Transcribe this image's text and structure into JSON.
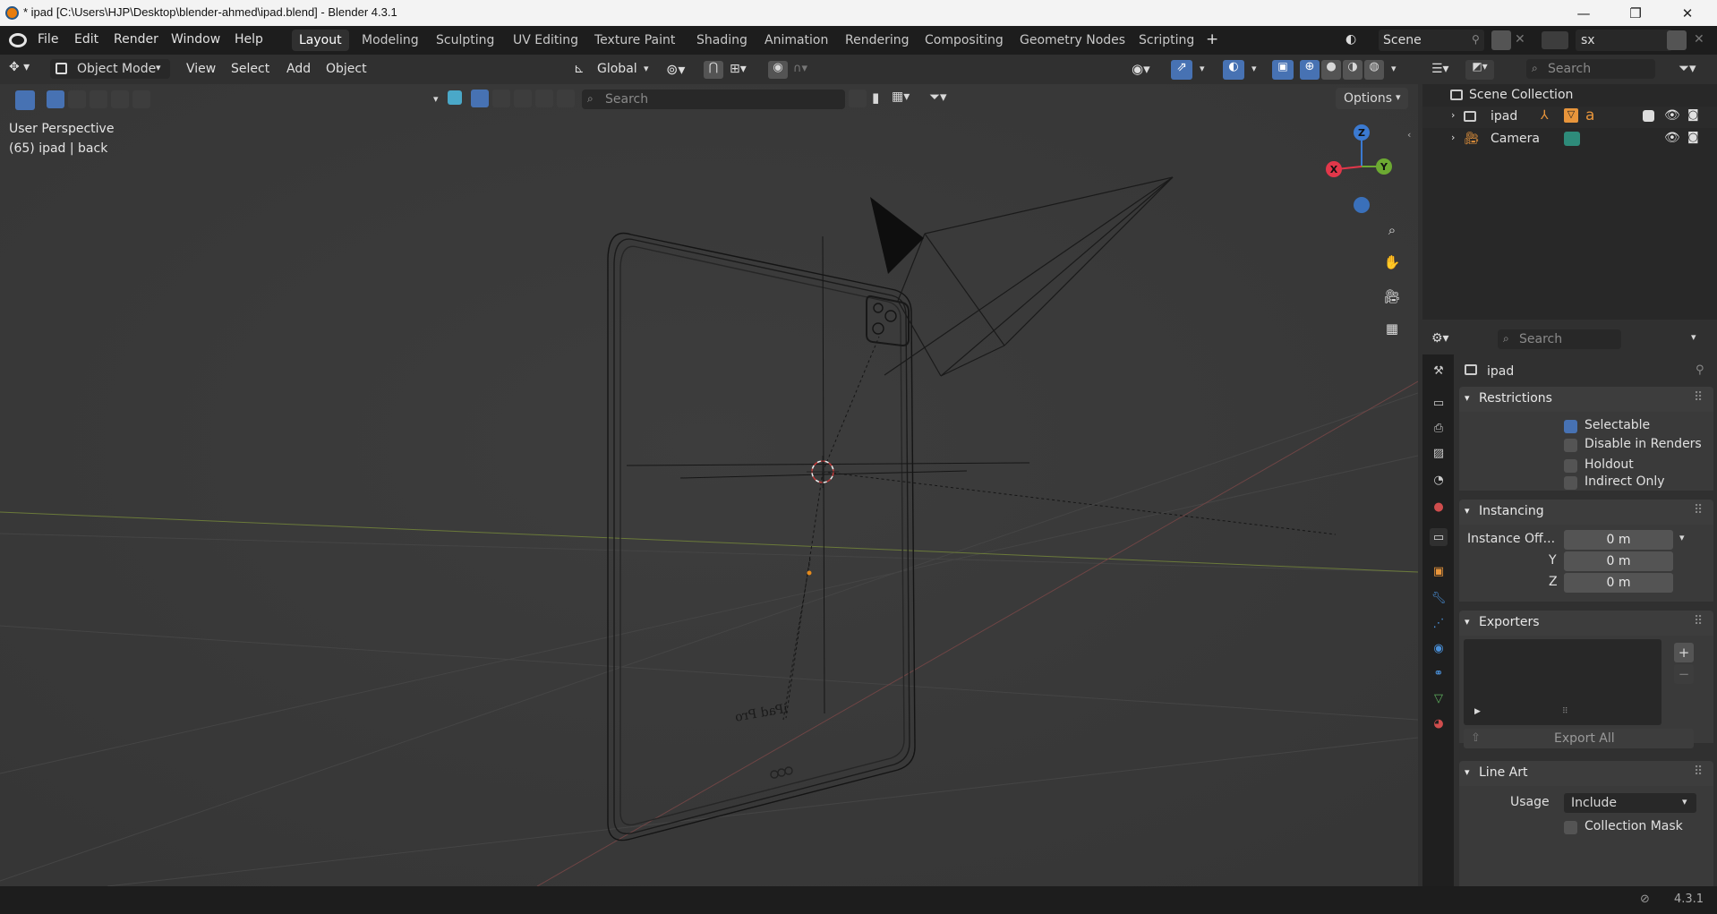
{
  "window": {
    "title": "* ipad [C:\\Users\\HJP\\Desktop\\blender-ahmed\\ipad.blend] - Blender 4.3.1",
    "controls": {
      "minimize": "—",
      "maximize": "❐",
      "close": "✕"
    }
  },
  "menu": {
    "file": "File",
    "edit": "Edit",
    "render": "Render",
    "window": "Window",
    "help": "Help"
  },
  "workspaces": [
    "Layout",
    "Modeling",
    "Sculpting",
    "UV Editing",
    "Texture Paint",
    "Shading",
    "Animation",
    "Rendering",
    "Compositing",
    "Geometry Nodes",
    "Scripting"
  ],
  "workspace_add": "+",
  "scene": {
    "name": "Scene",
    "view_layer": "sx"
  },
  "viewport_header": {
    "mode": "Object Mode",
    "view": "View",
    "select": "Select",
    "add": "Add",
    "object": "Object",
    "orientation": "Global",
    "search_placeholder": "Search",
    "options": "Options"
  },
  "viewport": {
    "perspective": "User Perspective",
    "collection_info": "(65) ipad | back",
    "engraving": "iPad Pro",
    "gizmo": {
      "x": "X",
      "y": "Y",
      "z": "Z"
    }
  },
  "outliner": {
    "search_placeholder": "Search",
    "root": "Scene Collection",
    "items": [
      {
        "label": "ipad",
        "visible": true,
        "renderable": true,
        "selectable": true
      },
      {
        "label": "Camera",
        "visible": true,
        "renderable": true
      }
    ]
  },
  "properties": {
    "search_placeholder": "Search",
    "context": "ipad",
    "restrictions": {
      "title": "Restrictions",
      "selectable": "Selectable",
      "disable_in_renders": "Disable in Renders",
      "holdout": "Holdout",
      "indirect_only": "Indirect Only"
    },
    "instancing": {
      "title": "Instancing",
      "offset_label": "Instance Off...",
      "x": "0 m",
      "y_label": "Y",
      "y": "0 m",
      "z_label": "Z",
      "z": "0 m"
    },
    "exporters": {
      "title": "Exporters",
      "export_all": "Export All",
      "add": "+",
      "remove": "−"
    },
    "line_art": {
      "title": "Line Art",
      "usage_label": "Usage",
      "usage": "Include",
      "collection_mask": "Collection Mask"
    }
  },
  "status": {
    "version": "4.3.1"
  },
  "colors": {
    "accent": "#4772b3",
    "x_axis": "#e2374a",
    "y_axis": "#6ca932",
    "z_axis": "#3b7ad1",
    "header": "#1d1d1d"
  }
}
